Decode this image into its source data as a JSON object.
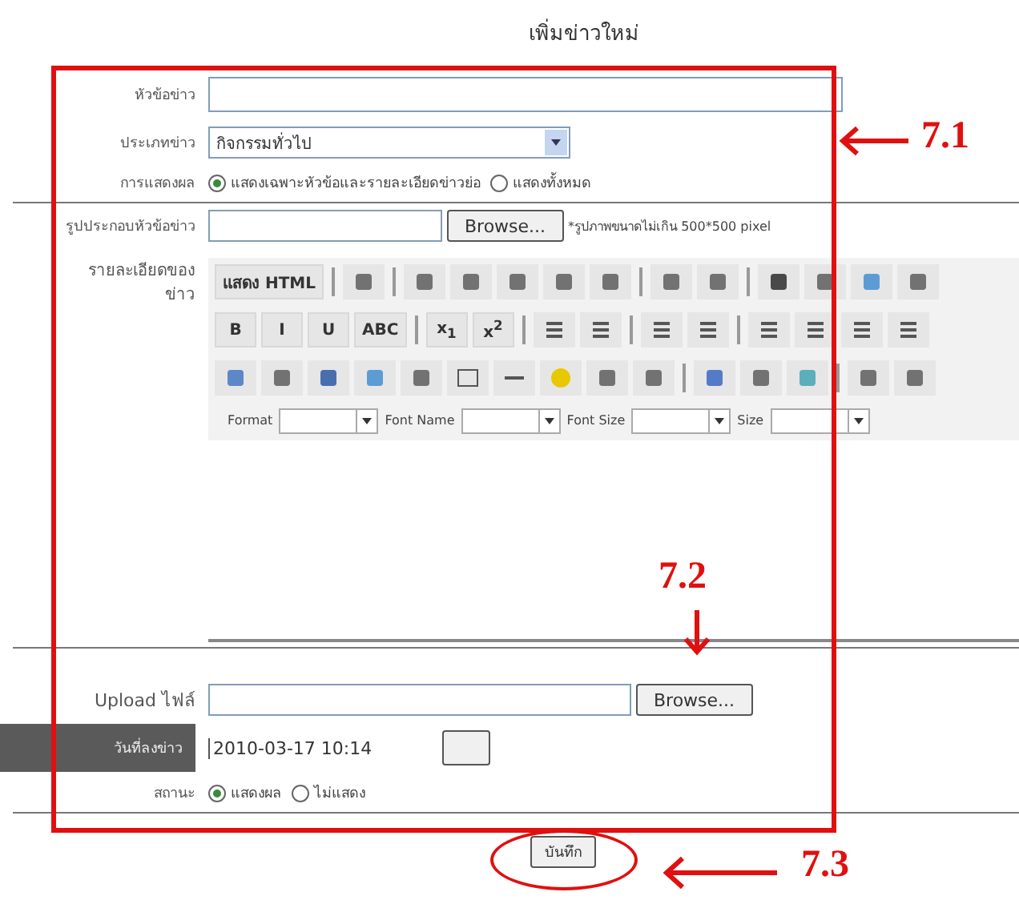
{
  "page_title": "เพิ่มข่าวใหม่",
  "headline": {
    "label": "หัวข้อข่าว"
  },
  "category": {
    "label": "ประเภทข่าว",
    "value": "กิจกรรมทั่วไป"
  },
  "display": {
    "label": "การแสดงผล",
    "options": [
      {
        "label": "แสดงเฉพาะหัวข้อและรายละเอียดข่าวย่อ",
        "selected": true
      },
      {
        "label": "แสดงทั้งหมด",
        "selected": false
      }
    ]
  },
  "image": {
    "label": "รูปประกอบหัวข้อข่าว",
    "button": "Browse...",
    "note": "*รูปภาพขนาดไม่เกิน 500*500 pixel"
  },
  "details": {
    "label": "รายละเอียดของ",
    "sublabel": "ข่าว",
    "toolbar_rows": [
      [
        {
          "kind": "text",
          "label": "แสดง HTML"
        },
        {
          "kind": "sep"
        },
        {
          "kind": "icon"
        },
        {
          "kind": "sep"
        },
        {
          "kind": "icon"
        },
        {
          "kind": "icon"
        },
        {
          "kind": "icon"
        },
        {
          "kind": "icon"
        },
        {
          "kind": "icon"
        },
        {
          "kind": "sep"
        },
        {
          "kind": "icon"
        },
        {
          "kind": "icon"
        },
        {
          "kind": "sep"
        },
        {
          "kind": "icon"
        },
        {
          "kind": "icon"
        },
        {
          "kind": "icon"
        },
        {
          "kind": "icon"
        }
      ],
      [
        {
          "kind": "text",
          "label": "B"
        },
        {
          "kind": "text",
          "label": "I"
        },
        {
          "kind": "text",
          "label": "U"
        },
        {
          "kind": "text",
          "label": "ABC"
        },
        {
          "kind": "sep"
        },
        {
          "kind": "text",
          "label": "x$_{1}$"
        },
        {
          "kind": "text",
          "label": "x$^{2}$"
        },
        {
          "kind": "sep"
        },
        {
          "kind": "icon"
        },
        {
          "kind": "icon"
        },
        {
          "kind": "sep"
        },
        {
          "kind": "icon"
        },
        {
          "kind": "icon"
        },
        {
          "kind": "sep"
        },
        {
          "kind": "icon"
        },
        {
          "kind": "icon"
        },
        {
          "kind": "icon"
        },
        {
          "kind": "icon"
        }
      ],
      [
        {
          "kind": "icon"
        },
        {
          "kind": "icon"
        },
        {
          "kind": "icon"
        },
        {
          "kind": "icon"
        },
        {
          "kind": "icon"
        },
        {
          "kind": "icon"
        },
        {
          "kind": "icon"
        },
        {
          "kind": "icon"
        },
        {
          "kind": "icon"
        },
        {
          "kind": "icon"
        },
        {
          "kind": "sep"
        },
        {
          "kind": "icon"
        },
        {
          "kind": "icon"
        },
        {
          "kind": "icon"
        },
        {
          "kind": "sep"
        },
        {
          "kind": "icon"
        },
        {
          "kind": "icon"
        }
      ]
    ],
    "font_selects": [
      {
        "label": "Format"
      },
      {
        "label": "Font Name"
      },
      {
        "label": "Font Size"
      },
      {
        "label": "Size"
      }
    ]
  },
  "upload": {
    "label": "Upload ไฟล์",
    "button": "Browse..."
  },
  "date": {
    "label": "วันที่ลงข่าว",
    "value": "2010-03-17 10:14"
  },
  "status": {
    "label": "สถานะ",
    "options": [
      {
        "label": "แสดงผล",
        "selected": true
      },
      {
        "label": "ไม่แสดง",
        "selected": false
      }
    ]
  },
  "submit": "บันทึก",
  "annotations": [
    {
      "label": "7.1"
    },
    {
      "label": "7.2"
    },
    {
      "label": "7.3"
    }
  ]
}
